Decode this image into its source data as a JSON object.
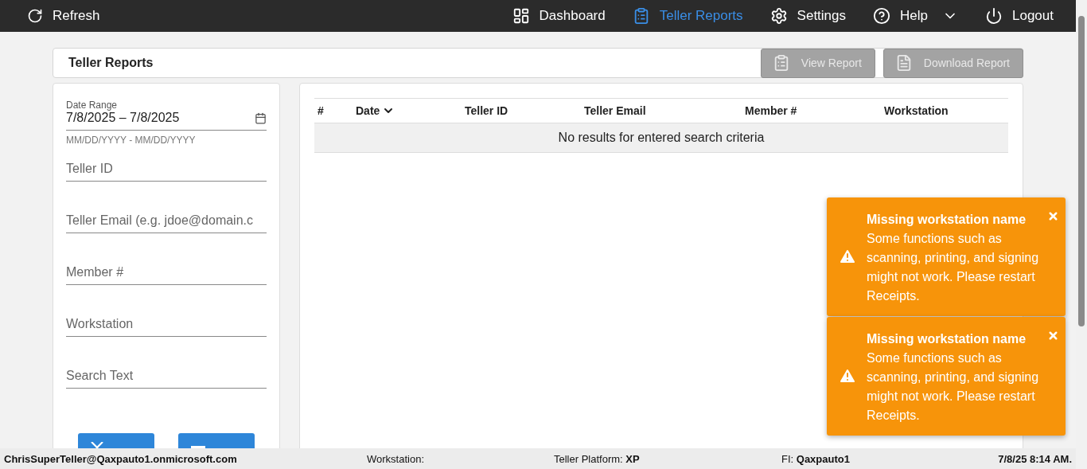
{
  "nav": {
    "refresh": "Refresh",
    "items": [
      {
        "kind": "dashboard",
        "label": "Dashboard",
        "selected": false
      },
      {
        "kind": "reports",
        "label": "Teller Reports",
        "selected": true
      },
      {
        "kind": "settings",
        "label": "Settings",
        "selected": false
      },
      {
        "kind": "help",
        "label": "Help",
        "selected": false,
        "dropdown": true
      },
      {
        "kind": "logout",
        "label": "Logout",
        "selected": false
      }
    ]
  },
  "header": {
    "title": "Teller Reports",
    "buttons": [
      {
        "kind": "view",
        "label": "View Report",
        "disabled": true
      },
      {
        "kind": "download",
        "label": "Download Report",
        "disabled": true
      }
    ]
  },
  "filters": {
    "date_range": {
      "label": "Date Range",
      "value": "7/8/2025 – 7/8/2025",
      "hint": "MM/DD/YYYY - MM/DD/YYYY"
    },
    "fields": [
      {
        "placeholder": "Teller ID"
      },
      {
        "placeholder": "Teller Email (e.g. jdoe@domain.c"
      },
      {
        "placeholder": "Member #"
      },
      {
        "placeholder": "Workstation"
      },
      {
        "placeholder": "Search Text"
      }
    ],
    "buttons": [
      {
        "kind": "clear"
      },
      {
        "kind": "apply"
      }
    ]
  },
  "table": {
    "columns": [
      {
        "label": "#",
        "sorted": false
      },
      {
        "label": "Date",
        "sorted": true
      },
      {
        "label": "Teller ID",
        "sorted": false
      },
      {
        "label": "Teller Email",
        "sorted": false
      },
      {
        "label": "Member #",
        "sorted": false
      },
      {
        "label": "Workstation",
        "sorted": false
      }
    ],
    "empty_message": "No results for entered search criteria"
  },
  "toasts": [
    {
      "title": "Missing workstation name",
      "message": "Some functions such as scanning, printing, and signing might not work. Please restart Receipts."
    },
    {
      "title": "Missing workstation name",
      "message": "Some functions such as scanning, printing, and signing might not work. Please restart Receipts."
    }
  ],
  "status_bar": {
    "user": "ChrisSuperTeller@Qaxpauto1.onmicrosoft.com",
    "workstation": "Workstation:",
    "platform": "Teller Platform: **XP**",
    "fi": "FI: **Qaxpauto1**",
    "time": "7/8/25 8:14 AM."
  }
}
